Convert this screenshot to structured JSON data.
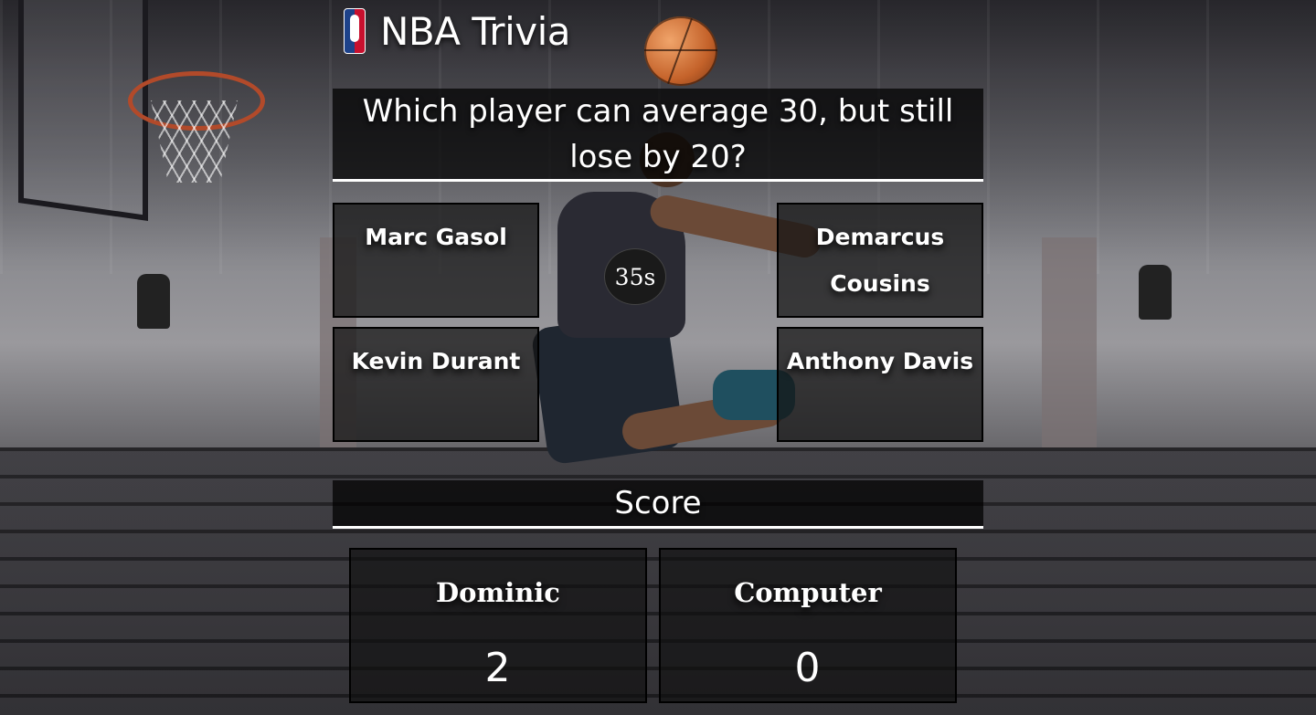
{
  "app": {
    "title": "NBA Trivia",
    "logo_icon": "nba-logo-icon"
  },
  "question": {
    "text": "Which player can average 30, but still lose by 20?"
  },
  "answers": [
    {
      "label": "Marc Gasol"
    },
    {
      "label": "Demarcus Cousins"
    },
    {
      "label": "Kevin Durant"
    },
    {
      "label": "Anthony Davis"
    }
  ],
  "timer": {
    "text": "35s"
  },
  "score": {
    "heading": "Score",
    "players": [
      {
        "name": "Dominic",
        "points": "2"
      },
      {
        "name": "Computer",
        "points": "0"
      }
    ]
  }
}
